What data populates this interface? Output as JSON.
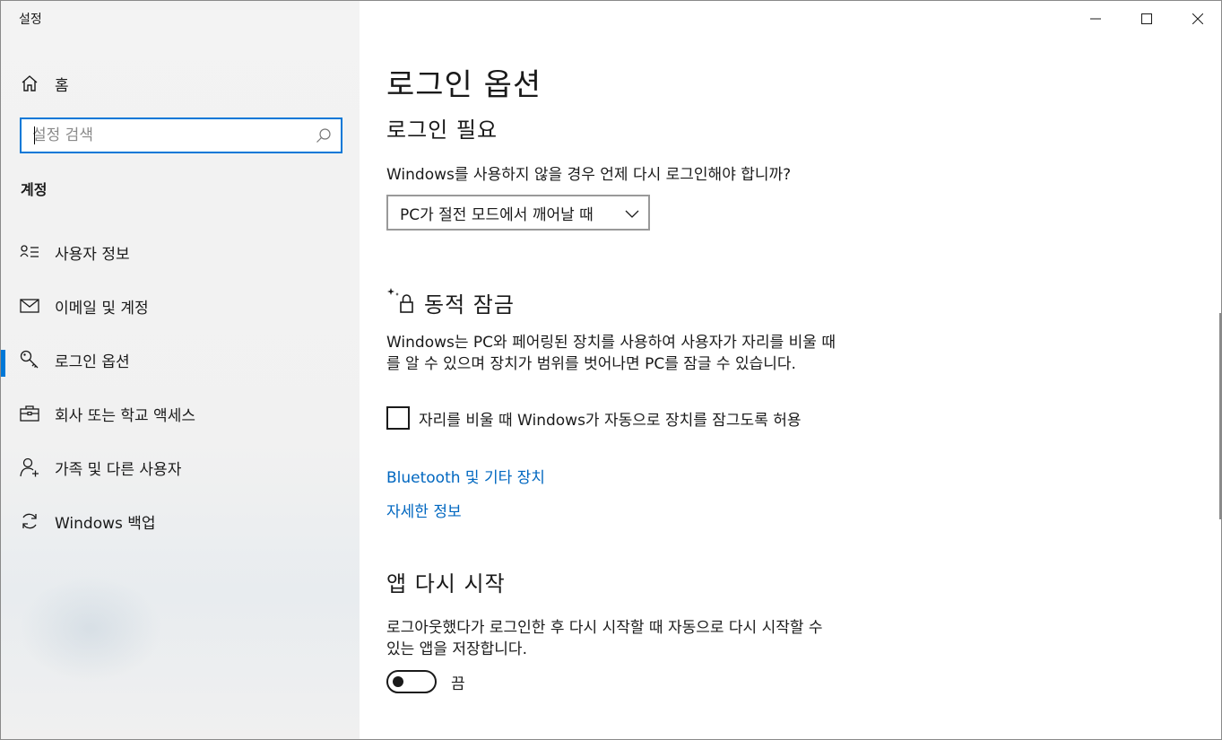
{
  "app": {
    "title": "설정"
  },
  "window_controls": {
    "minimize": "minimize-icon",
    "maximize": "maximize-icon",
    "close": "close-icon"
  },
  "sidebar": {
    "home_label": "홈",
    "search": {
      "placeholder": "설정 검색"
    },
    "section_title": "계정",
    "items": [
      {
        "label": "사용자 정보",
        "icon": "user-info-icon",
        "active": false
      },
      {
        "label": "이메일 및 계정",
        "icon": "mail-icon",
        "active": false
      },
      {
        "label": "로그인 옵션",
        "icon": "key-icon",
        "active": true
      },
      {
        "label": "회사 또는 학교 액세스",
        "icon": "briefcase-icon",
        "active": false
      },
      {
        "label": "가족 및 다른 사용자",
        "icon": "person-add-icon",
        "active": false
      },
      {
        "label": "Windows 백업",
        "icon": "sync-icon",
        "active": false
      }
    ]
  },
  "main": {
    "page_title": "로그인 옵션",
    "require_signin": {
      "heading": "로그인 필요",
      "question": "Windows를 사용하지 않을 경우 언제 다시 로그인해야 합니까?",
      "dropdown_value": "PC가 절전 모드에서 깨어날 때"
    },
    "dynamic_lock": {
      "heading": "동적 잠금",
      "description_line1": "Windows는 PC와 페어링된 장치를 사용하여 사용자가 자리를 비울 때",
      "description_line2": "를 알 수 있으며 장치가 범위를 벗어나면 PC를 잠글 수 있습니다.",
      "checkbox_label": "자리를 비울 때 Windows가 자동으로 장치를 잠그도록 허용",
      "checkbox_checked": false,
      "link_bluetooth": "Bluetooth 및 기타 장치",
      "link_more_info": "자세한 정보"
    },
    "restart_apps": {
      "heading": "앱 다시 시작",
      "description_line1": "로그아웃했다가 로그인한 후 다시 시작할 때 자동으로 다시 시작할 수",
      "description_line2": "있는 앱을 저장합니다.",
      "toggle_state": "끔"
    }
  }
}
